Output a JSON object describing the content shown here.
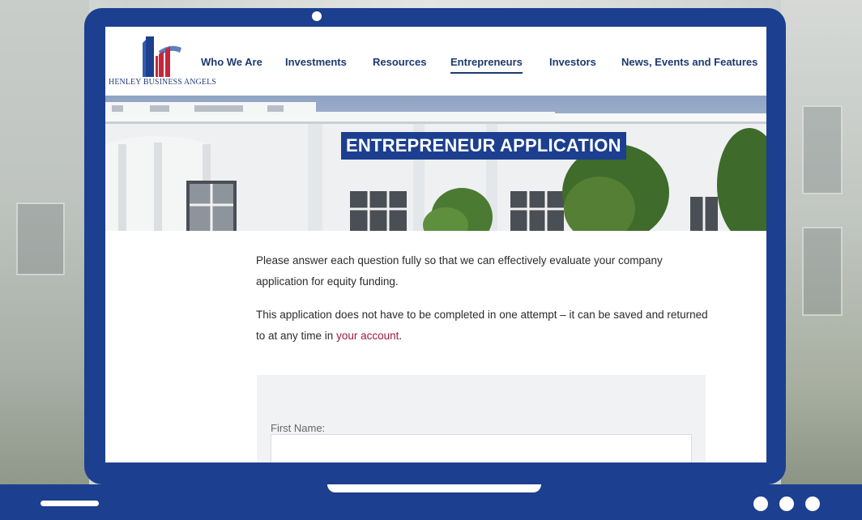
{
  "site": {
    "logo_text": "HENLEY BUSINESS ANGELS",
    "nav": [
      {
        "label": "Who We Are",
        "active": false
      },
      {
        "label": "Investments",
        "active": false
      },
      {
        "label": "Resources",
        "active": false
      },
      {
        "label": "Entrepreneurs",
        "active": true
      },
      {
        "label": "Investors",
        "active": false
      },
      {
        "label": "News, Events and Features",
        "active": false
      }
    ]
  },
  "hero": {
    "title": "ENTREPRENEUR APPLICATION"
  },
  "content": {
    "paragraph1": "Please answer each question fully so that we can effectively evaluate your company application for equity funding.",
    "paragraph2_before": "This application does not have to be completed in one attempt – it can be saved and returned to at any time in ",
    "paragraph2_link": "your account",
    "paragraph2_after": "."
  },
  "form": {
    "first_name_label": "First Name:",
    "first_name_value": ""
  },
  "colors": {
    "frame": "#1c3f8f",
    "nav_text": "#1d3a6e",
    "link": "#a0183a",
    "logo_red": "#c4283a"
  }
}
